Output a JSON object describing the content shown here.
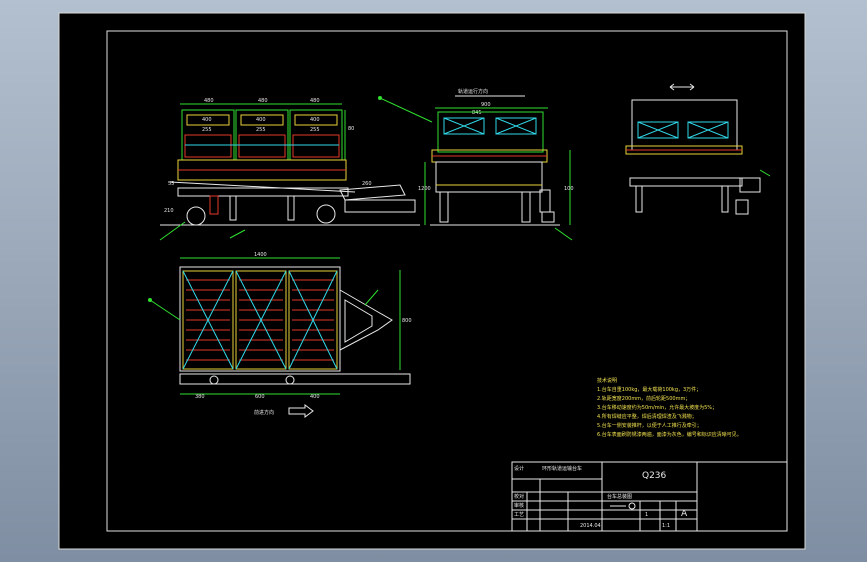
{
  "drawing": {
    "direction_top": "轨道运行方向",
    "direction_bottom": "前进方向",
    "material": "Q236",
    "sheet_label": "A",
    "dims": {
      "top_widths": [
        "480",
        "480",
        "480"
      ],
      "top_inner": [
        "400",
        "400",
        "400"
      ],
      "top_small": [
        "255",
        "255",
        "255"
      ],
      "right_height": "80",
      "left_h1": "55",
      "left_h2": "210",
      "side_width": "900",
      "side_inner": "845",
      "side_h": "1200",
      "side_h2": "100",
      "plan_length": "1400",
      "plan_width": "800",
      "plan_b1": "380",
      "plan_b2": "600",
      "plan_b3": "400",
      "tow": "260"
    },
    "notes": [
      "技术说明",
      "1.台车自重100kg，最大载荷100kg，3万件；",
      "2.轨距宽度200mm，前后轮距500mm；",
      "3.台车移动速度约为50m/min，允许最大坡度为5%；",
      "4.所有焊缝应平整，焊后清理焊渣及飞溅物；",
      "5.台车一侧安装推杆，以便于人工推行及牵引；",
      "6.台车表面刷防锈漆两遍，面漆为灰色，编号和标识应清晰可见。"
    ],
    "title_block": {
      "row_label_1": "设计",
      "row_label_2": "校对",
      "row_label_3": "审核",
      "row_label_4": "工艺",
      "designer_top": "环形轨道运输台车",
      "part_name": "台车总装图",
      "material_label": "Q236",
      "quantity": "1",
      "scale": "1:1",
      "date": "2014.04"
    }
  }
}
